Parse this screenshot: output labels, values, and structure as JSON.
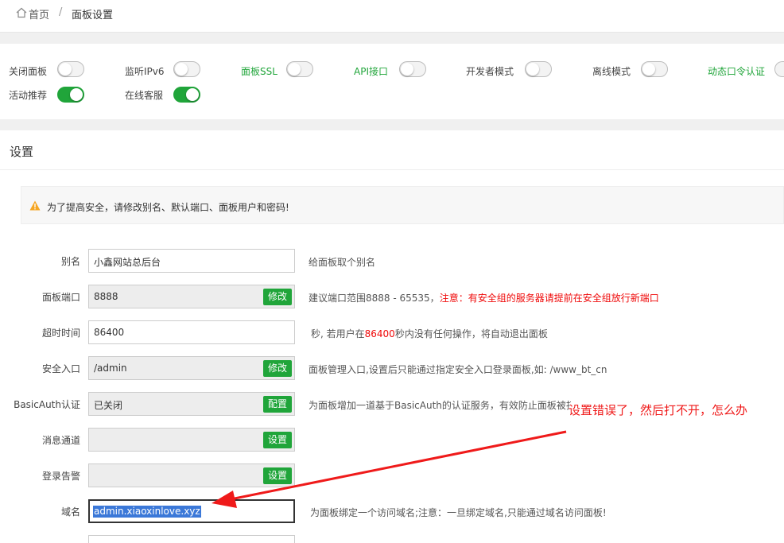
{
  "breadcrumb": {
    "home": "首页",
    "separator": "/",
    "current": "面板设置"
  },
  "toggles": [
    {
      "label": "关闭面板",
      "on": false,
      "green": false
    },
    {
      "label": "监听IPv6",
      "on": false,
      "green": false
    },
    {
      "label": "面板SSL",
      "on": false,
      "green": true
    },
    {
      "label": "API接口",
      "on": false,
      "green": true
    },
    {
      "label": "开发者模式",
      "on": false,
      "green": false
    },
    {
      "label": "离线模式",
      "on": false,
      "green": false
    },
    {
      "label": "动态口令认证",
      "on": false,
      "green": true
    },
    {
      "label": "活动推荐",
      "on": true,
      "green": false
    },
    {
      "label": "在线客服",
      "on": true,
      "green": false
    }
  ],
  "settings": {
    "title": "设置",
    "warning": "为了提高安全，请修改别名、默认端口、面板用户和密码!",
    "rows": {
      "alias": {
        "label": "别名",
        "value": "小鑫网站总后台",
        "desc": "给面板取个别名"
      },
      "port": {
        "label": "面板端口",
        "value": "8888",
        "button": "修改",
        "desc": "建议端口范围8888 - 65535，",
        "desc_red": "注意：有安全组的服务器请提前在安全组放行新端口"
      },
      "timeout": {
        "label": "超时时间",
        "value": "86400",
        "desc_pre": "秒, 若用户在",
        "desc_red": "86400",
        "desc_post": "秒内没有任何操作，将自动退出面板"
      },
      "entry": {
        "label": "安全入口",
        "value": "/admin",
        "button": "修改",
        "desc": "面板管理入口,设置后只能通过指定安全入口登录面板,如: /www_bt_cn"
      },
      "basicauth": {
        "label": "BasicAuth认证",
        "value": "已关闭",
        "button": "配置",
        "desc": "为面板增加一道基于BasicAuth的认证服务，有效防止面板被扫"
      },
      "message": {
        "label": "消息通道",
        "value": "",
        "button": "设置"
      },
      "alarm": {
        "label": "登录告警",
        "value": "",
        "button": "设置"
      },
      "domain": {
        "label": "域名",
        "value": "admin.xiaoxinlove.xyz",
        "desc": "为面板绑定一个访问域名;注意：一旦绑定域名,只能通过域名访问面板!"
      }
    }
  },
  "annotation": {
    "text": "设置错误了，然后打不开，怎么办"
  },
  "colors": {
    "accent": "#20a53a",
    "danger": "#ef0808",
    "warning": "#f5a623",
    "annotation": "#ef1a1a"
  }
}
